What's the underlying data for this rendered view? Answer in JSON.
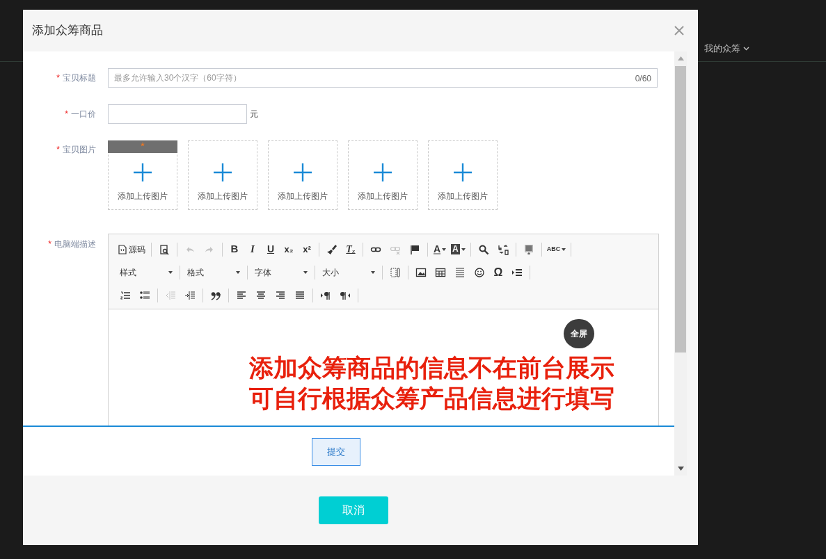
{
  "background_page": {
    "nav_item": "我的众筹"
  },
  "dialog": {
    "title": "添加众筹商品",
    "form": {
      "title_field": {
        "label": "宝贝标题",
        "required": true,
        "placeholder": "最多允许输入30个汉字（60字符）",
        "counter": "0/60"
      },
      "price_field": {
        "label": "一口价",
        "required": true,
        "unit": "元"
      },
      "images": {
        "label": "宝贝图片",
        "required": true,
        "slots": [
          {
            "label": "添加上传图片",
            "main": true,
            "badge": "*"
          },
          {
            "label": "添加上传图片",
            "main": false
          },
          {
            "label": "添加上传图片",
            "main": false
          },
          {
            "label": "添加上传图片",
            "main": false
          },
          {
            "label": "添加上传图片",
            "main": false
          }
        ]
      },
      "description": {
        "label": "电脑端描述",
        "required": true,
        "toolbar_rows": [
          [
            {
              "kind": "source",
              "label": "源码",
              "disabled": false
            },
            {
              "kind": "sep"
            },
            {
              "kind": "preview",
              "disabled": false
            },
            {
              "kind": "sep"
            },
            {
              "kind": "undo",
              "disabled": true
            },
            {
              "kind": "redo",
              "disabled": true
            },
            {
              "kind": "sep"
            },
            {
              "kind": "bold",
              "glyph": "B",
              "disabled": false
            },
            {
              "kind": "italic",
              "glyph": "I",
              "disabled": false
            },
            {
              "kind": "underline",
              "glyph": "U",
              "disabled": false
            },
            {
              "kind": "subscript",
              "glyph": "x₂",
              "disabled": false
            },
            {
              "kind": "superscript",
              "glyph": "x²",
              "disabled": false
            },
            {
              "kind": "sep"
            },
            {
              "kind": "brush",
              "disabled": false
            },
            {
              "kind": "clearformat",
              "glyph": "Tₓ",
              "disabled": false
            },
            {
              "kind": "sep"
            },
            {
              "kind": "link",
              "disabled": false
            },
            {
              "kind": "unlink",
              "disabled": true
            },
            {
              "kind": "flag",
              "disabled": false
            },
            {
              "kind": "sep"
            },
            {
              "kind": "textcolor",
              "glyph": "A",
              "disabled": false
            },
            {
              "kind": "bgcolor",
              "glyph": "A",
              "disabled": false
            },
            {
              "kind": "sep"
            },
            {
              "kind": "find",
              "disabled": false
            },
            {
              "kind": "replace",
              "disabled": false
            },
            {
              "kind": "sep"
            },
            {
              "kind": "template",
              "disabled": false
            },
            {
              "kind": "sep"
            },
            {
              "kind": "spellcheck",
              "glyph": "ABC",
              "disabled": false
            },
            {
              "kind": "sep"
            }
          ],
          [
            {
              "kind": "dropdown",
              "label": "样式"
            },
            {
              "kind": "sep"
            },
            {
              "kind": "dropdown",
              "label": "格式"
            },
            {
              "kind": "sep"
            },
            {
              "kind": "dropdown",
              "label": "字体"
            },
            {
              "kind": "sep"
            },
            {
              "kind": "dropdown",
              "label": "大小"
            },
            {
              "kind": "sep"
            },
            {
              "kind": "blocks",
              "disabled": false
            },
            {
              "kind": "sep"
            },
            {
              "kind": "image",
              "disabled": false
            },
            {
              "kind": "table",
              "disabled": false
            },
            {
              "kind": "rule",
              "disabled": false
            },
            {
              "kind": "smiley",
              "disabled": false
            },
            {
              "kind": "omega",
              "glyph": "Ω",
              "disabled": false
            },
            {
              "kind": "pagebreak",
              "disabled": false
            },
            {
              "kind": "sep"
            }
          ],
          [
            {
              "kind": "numbered",
              "disabled": false
            },
            {
              "kind": "bulleted",
              "disabled": false
            },
            {
              "kind": "sep"
            },
            {
              "kind": "outdent",
              "disabled": true
            },
            {
              "kind": "indent",
              "disabled": false
            },
            {
              "kind": "sep"
            },
            {
              "kind": "quote",
              "disabled": false
            },
            {
              "kind": "sep"
            },
            {
              "kind": "alignleft",
              "disabled": false
            },
            {
              "kind": "aligncenter",
              "disabled": false
            },
            {
              "kind": "alignright",
              "disabled": false
            },
            {
              "kind": "justify",
              "disabled": false
            },
            {
              "kind": "sep"
            },
            {
              "kind": "ltr",
              "disabled": false
            },
            {
              "kind": "rtl",
              "disabled": false
            },
            {
              "kind": "sep"
            }
          ]
        ],
        "fullscreen_button": "全屏",
        "notice": [
          "添加众筹商品的信息不在前台展示",
          "可自行根据众筹产品信息进行填写"
        ]
      },
      "submit": "提交"
    },
    "cancel": "取消"
  }
}
